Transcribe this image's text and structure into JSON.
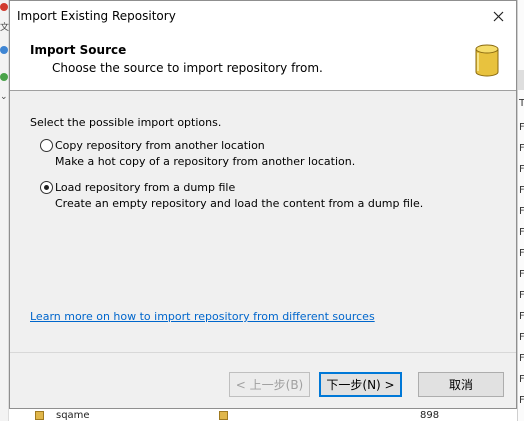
{
  "dialog": {
    "title": "Import Existing Repository",
    "header_title": "Import Source",
    "header_subtitle": "Choose the source to import repository from.",
    "section_label": "Select the possible import options.",
    "options": [
      {
        "label": "Copy repository from another location",
        "description": "Make a hot copy of a repository from another location.",
        "selected": false
      },
      {
        "label": "Load repository from a dump file",
        "description": "Create an empty repository and load the content from a dump file.",
        "selected": true
      }
    ],
    "learn_more_link": "Learn more on how to import repository from different sources",
    "buttons": {
      "back": "< 上一步(B)",
      "next": "下一步(N) >",
      "cancel": "取消"
    }
  },
  "background": {
    "left_glyph": "文",
    "right_header": "T",
    "right_row_letter": "F",
    "tree_node": "sqame",
    "tree_value": "898"
  },
  "colors": {
    "link": "#0066cc",
    "accent": "#0078d7",
    "db_icon": "#e8c23e"
  }
}
